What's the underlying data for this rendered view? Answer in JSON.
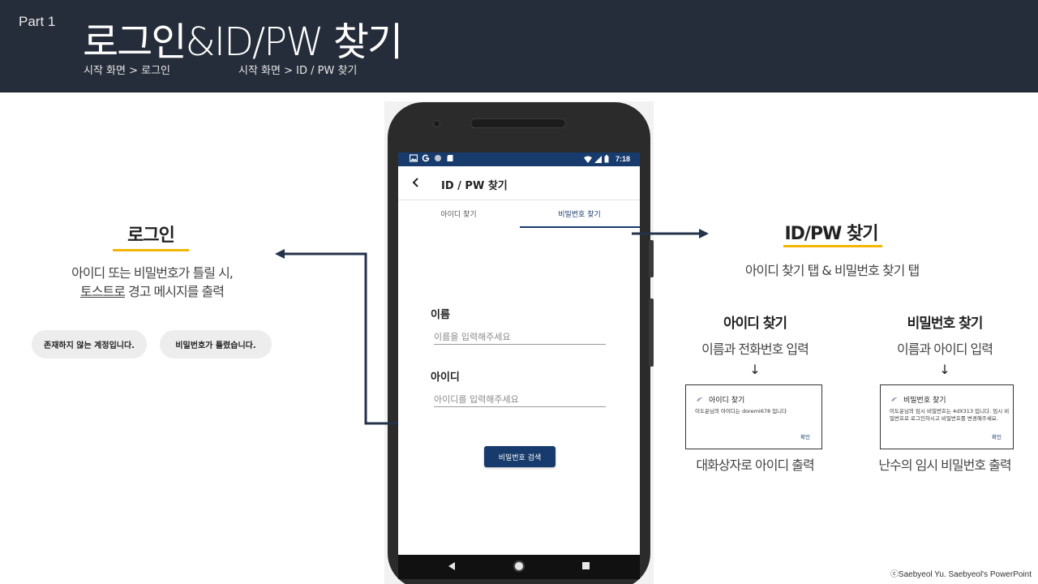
{
  "header": {
    "part": "Part 1",
    "title": "로그인&ID/PW 찾기",
    "crumb_login": "시작 화면 > 로그인",
    "crumb_find": "시작 화면 > ID / PW 찾기"
  },
  "left": {
    "title": "로그인",
    "desc_line1": "아이디 또는 비밀번호가 틀릴 시,",
    "desc_line2_ul": "토스트로",
    "desc_line2_rest": " 경고 메시지를 출력",
    "toast_1": "존재하지 않는 계정입니다.",
    "toast_2": "비밀번호가 틀렸습니다."
  },
  "phone": {
    "status_time": "7:18",
    "appbar_title": "ID / PW 찾기",
    "tab_id": "아이디 찾기",
    "tab_pw": "비밀번호 찾기",
    "name_label": "이름",
    "name_placeholder": "이름을 입력해주세요",
    "id_label": "아이디",
    "id_placeholder": "아이디를 입력해주세요",
    "search_button": "비밀번호 검색"
  },
  "right": {
    "title": "ID/PW 찾기",
    "sub": "아이디 찾기 탭 & 비밀번호 찾기 탭",
    "col_id": {
      "title": "아이디 찾기",
      "desc": "이름과 전화번호 입력",
      "arrow": "↓",
      "dialog_title": "아이디 찾기",
      "dialog_body": "이도운님의 아이디는 doremi678 입니다",
      "dialog_ok": "확인",
      "caption": "대화상자로 아이디 출력"
    },
    "col_pw": {
      "title": "비밀번호 찾기",
      "desc": "이름과 아이디 입력",
      "arrow": "↓",
      "dialog_title": "비밀번호 찾기",
      "dialog_body": "이도운님의 임시 비밀번호는 4dX313 입니다. 임시 비밀번호로 로그인하시고 비밀번호를 변경해주세요.",
      "dialog_ok": "확인",
      "caption": "난수의 임시 비밀번호 출력"
    }
  },
  "copyright": "ⓒSaebyeol Yu. Saebyeol's PowerPoint",
  "colors": {
    "banner": "#262d3a",
    "accent_navy": "#173b6c",
    "underline_gold": "#f2b600",
    "arrow": "#24324a"
  }
}
